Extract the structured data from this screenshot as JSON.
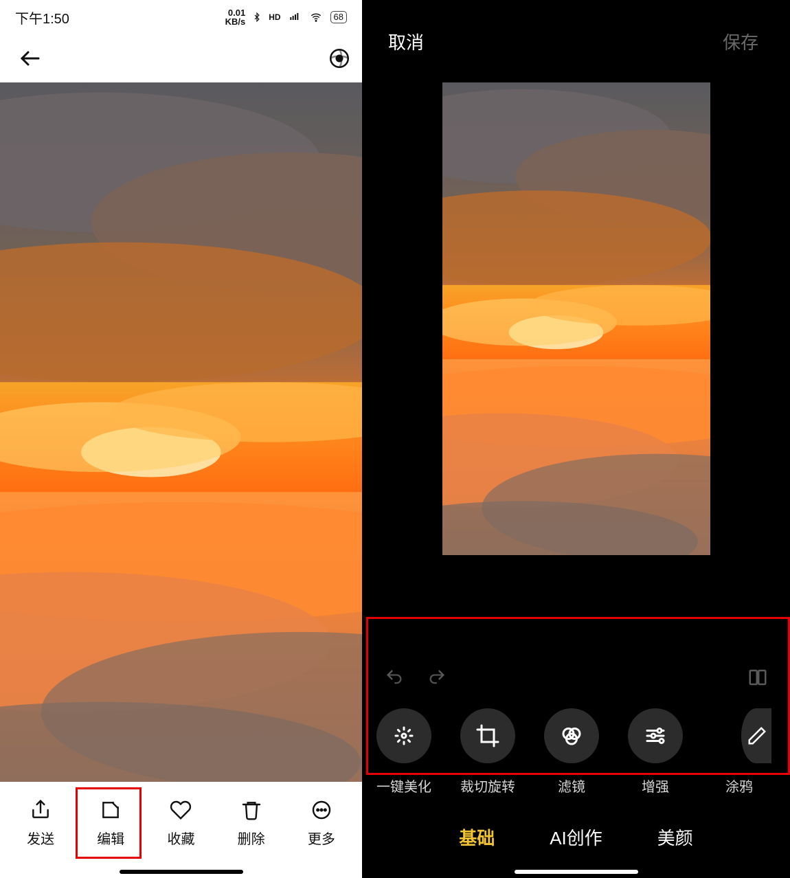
{
  "left": {
    "status": {
      "time": "下午1:50",
      "kbs_top": "0.01",
      "kbs_bot": "KB/s",
      "hd": "HD",
      "battery": "68"
    },
    "bottom": [
      {
        "icon": "share",
        "label": "发送"
      },
      {
        "icon": "edit",
        "label": "编辑"
      },
      {
        "icon": "heart",
        "label": "收藏"
      },
      {
        "icon": "trash",
        "label": "删除"
      },
      {
        "icon": "more",
        "label": "更多"
      }
    ]
  },
  "right": {
    "cancel": "取消",
    "save": "保存",
    "tools": [
      {
        "icon": "magic",
        "label": "一键美化"
      },
      {
        "icon": "crop",
        "label": "裁切旋转"
      },
      {
        "icon": "filter",
        "label": "滤镜"
      },
      {
        "icon": "sliders",
        "label": "增强"
      },
      {
        "icon": "pencil",
        "label": "涂鸦"
      }
    ],
    "tabs": [
      {
        "label": "基础",
        "active": true
      },
      {
        "label": "AI创作",
        "active": false
      },
      {
        "label": "美颜",
        "active": false
      }
    ]
  }
}
